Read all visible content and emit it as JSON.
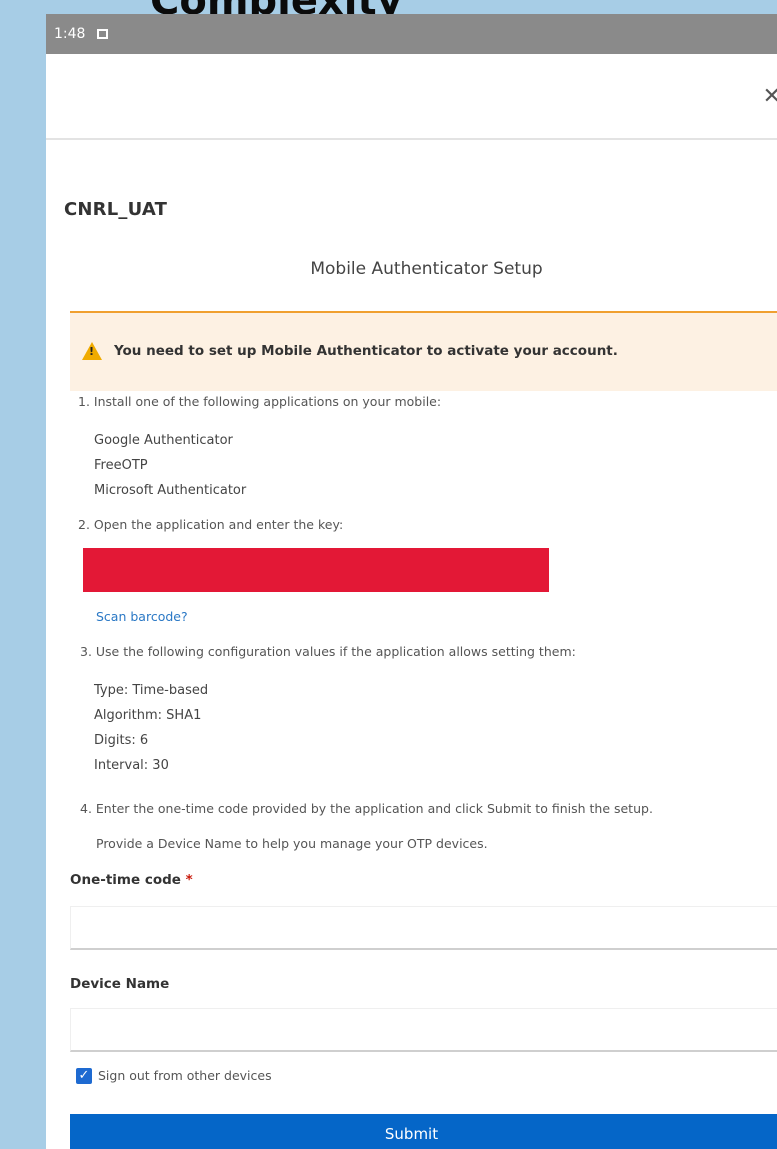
{
  "heading_overlay": "Complexity",
  "status_bar": {
    "time": "1:48"
  },
  "realm_name": "CNRL_UAT",
  "page_title": "Mobile Authenticator Setup",
  "alert": {
    "message": "You need to set up Mobile Authenticator to activate your account."
  },
  "steps": {
    "step1": "1. Install one of the following applications on your mobile:",
    "apps": [
      "Google Authenticator",
      "FreeOTP",
      "Microsoft Authenticator"
    ],
    "step2": "2. Open the application and enter the key:",
    "scan_link": "Scan barcode?",
    "step3": "3. Use the following configuration values if the application allows setting them:",
    "config": [
      "Type: Time-based",
      "Algorithm: SHA1",
      "Digits: 6",
      "Interval: 30"
    ],
    "step4": "4. Enter the one-time code provided by the application and click Submit to finish the setup.",
    "device_hint": "Provide a Device Name to help you manage your OTP devices."
  },
  "form": {
    "otp_label": "One-time code",
    "otp_required_mark": "*",
    "otp_value": "",
    "device_label": "Device Name",
    "device_value": "",
    "signout_label": "Sign out from other devices",
    "submit_label": "Submit"
  },
  "colors": {
    "submit_bg": "#0566c8",
    "redaction": "#e31836",
    "alert_bg": "#fdf1e3",
    "alert_border": "#f0a030",
    "link": "#2a78c5"
  }
}
